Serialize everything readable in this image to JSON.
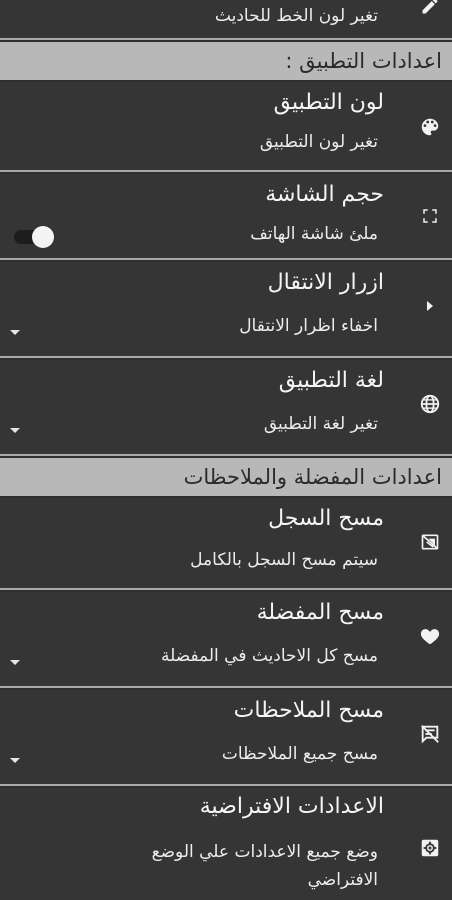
{
  "top_item": {
    "subtitle": "تغير لون الخط للحاديث",
    "icon": "pencil-icon"
  },
  "sections": {
    "app": "اعدادات التطبيق :",
    "favorites": "اعدادات المفضلة والملاحظات"
  },
  "items": {
    "app_color": {
      "title": "لون التطبيق",
      "subtitle": "تغير لون التطبيق",
      "icon": "palette-icon"
    },
    "screen_size": {
      "title": "حجم الشاشة",
      "subtitle": "ملئ شاشة الهاتف",
      "icon": "fullscreen-icon",
      "toggle_on": false
    },
    "nav_buttons": {
      "title": "ازرار الانتقال",
      "subtitle": "اخفاء اظرار الانتقال",
      "icon": "chevron-right-icon"
    },
    "app_language": {
      "title": "لغة التطبيق",
      "subtitle": "تغير لغة التطبيق",
      "icon": "globe-icon"
    },
    "clear_history": {
      "title": "مسح السجل",
      "subtitle": "سيتم مسح السجل بالكامل",
      "icon": "clear-history-icon"
    },
    "clear_favorites": {
      "title": "مسح المفضلة",
      "subtitle": "مسح كل الاحاديث في المفضلة",
      "icon": "heart-icon"
    },
    "clear_notes": {
      "title": "مسح الملاحظات",
      "subtitle": "مسح جميع الملاحظات",
      "icon": "clear-notes-icon"
    },
    "defaults": {
      "title": "الاعدادات الافتراضية",
      "subtitle": "وضع جميع الاعدادات علي الوضع الافتراضي",
      "icon": "gear-icon"
    }
  },
  "colors": {
    "background": "#2e2e2e",
    "item": "#353535",
    "section": "#b8b8b8",
    "divider": "#a9a9a9"
  }
}
